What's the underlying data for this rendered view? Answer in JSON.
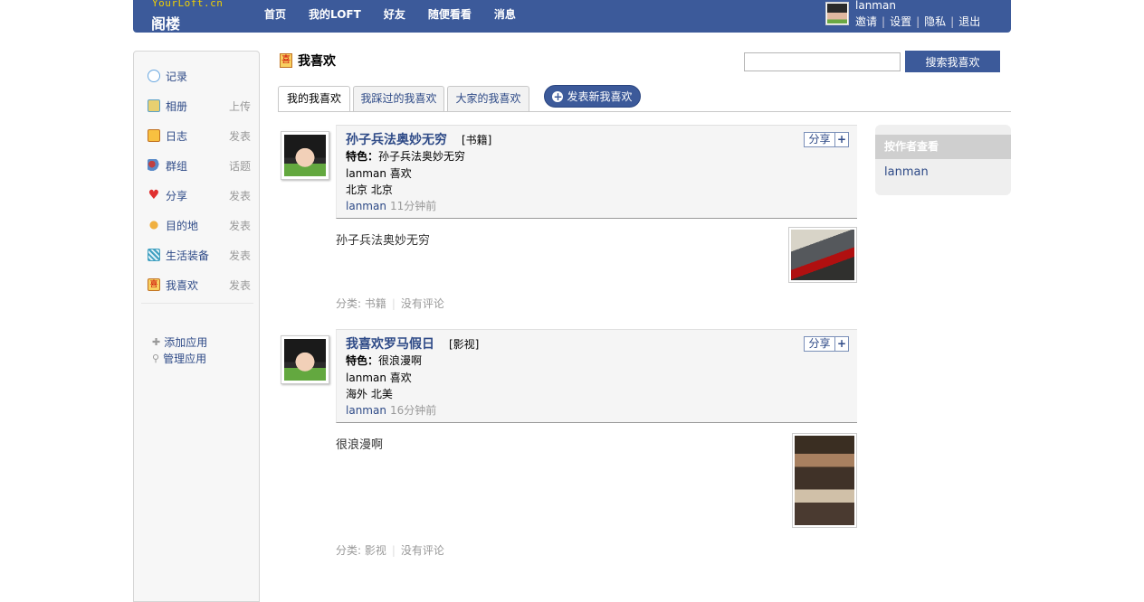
{
  "brand": {
    "small": "YourLoft.cn",
    "name": "阁楼"
  },
  "nav": [
    "首页",
    "我的LOFT",
    "好友",
    "随便看看",
    "消息"
  ],
  "user": {
    "name": "lanman",
    "links": [
      "邀请",
      "设置",
      "隐私",
      "退出"
    ]
  },
  "sidebar": {
    "items": [
      {
        "label": "记录",
        "action": "",
        "icon": "speech-bubble-icon",
        "color": "#6aa8e0"
      },
      {
        "label": "相册",
        "action": "上传",
        "icon": "photo-icon",
        "color": "#5aa0c8"
      },
      {
        "label": "日志",
        "action": "发表",
        "icon": "lock-icon",
        "color": "#f0a020"
      },
      {
        "label": "群组",
        "action": "话题",
        "icon": "group-icon",
        "color": "#c04040"
      },
      {
        "label": "分享",
        "action": "发表",
        "icon": "heart-icon",
        "color": "#e03030"
      },
      {
        "label": "目的地",
        "action": "发表",
        "icon": "hand-icon",
        "color": "#f0b040"
      },
      {
        "label": "生活装备",
        "action": "发表",
        "icon": "grid-icon",
        "color": "#40a0c0"
      },
      {
        "label": "我喜欢",
        "action": "发表",
        "icon": "like-icon",
        "color": "#f0a020"
      }
    ],
    "apps": [
      {
        "label": "添加应用",
        "icon": "plus-icon"
      },
      {
        "label": "管理应用",
        "icon": "wrench-icon"
      }
    ]
  },
  "page": {
    "title": "我喜欢",
    "title_icon_text": "喜"
  },
  "search": {
    "value": "",
    "button": "搜索我喜欢"
  },
  "tabs": [
    "我的我喜欢",
    "我踩过的我喜欢",
    "大家的我喜欢"
  ],
  "new_button": "发表新我喜欢",
  "posts": [
    {
      "title": "孙子兵法奥妙无穷",
      "category_tag": "[书籍]",
      "feature_label": "特色：",
      "feature": "孙子兵法奥妙无穷",
      "liker": "lanman 喜欢",
      "location": "北京  北京",
      "author": "lanman",
      "time": "11分钟前",
      "body": "孙子兵法奥妙无穷",
      "share": "分享",
      "footer_category": "分类: 书籍",
      "footer_comments": "没有评论"
    },
    {
      "title": "我喜欢罗马假日",
      "category_tag": "[影视]",
      "feature_label": "特色：",
      "feature": "很浪漫啊",
      "liker": "lanman 喜欢",
      "location": "海外  北美",
      "author": "lanman",
      "time": "16分钟前",
      "body": "很浪漫啊",
      "share": "分享",
      "footer_category": "分类: 影视",
      "footer_comments": "没有评论"
    }
  ],
  "right": {
    "heading": "按作者查看",
    "author": "lanman"
  }
}
